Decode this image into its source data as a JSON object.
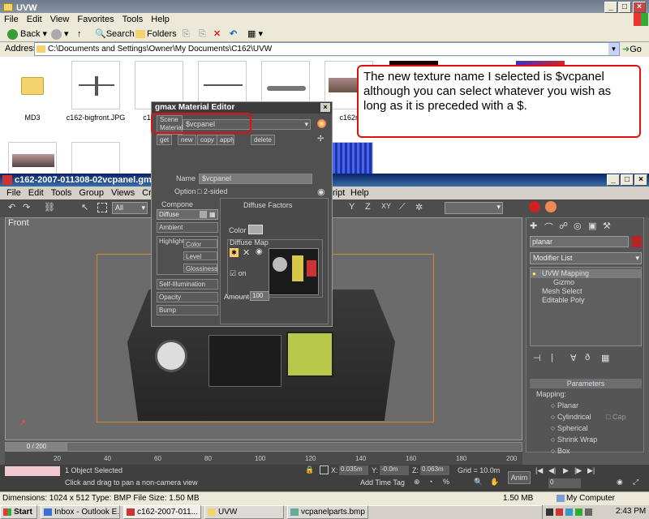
{
  "explorer": {
    "title": "UVW",
    "menu": [
      "File",
      "Edit",
      "View",
      "Favorites",
      "Tools",
      "Help"
    ],
    "toolbar": {
      "back": "Back",
      "search": "Search",
      "folders": "Folders"
    },
    "address_label": "Address",
    "address": "C:\\Documents and Settings\\Owner\\My Documents\\C162\\UVW",
    "go": "Go",
    "files": [
      "MD3",
      "c162-bigfront.JPG",
      "c162",
      "c162rw-le"
    ]
  },
  "note": {
    "text": "The new texture name I selected is $vcpanel although you can select whatever you wish as long as it is preceded with a $."
  },
  "gmax_window": {
    "title": "c162-2007-011308-02vcpanel.gmax - ",
    "menu": [
      "File",
      "Edit",
      "Tools",
      "Group",
      "Views",
      "Create",
      "M"
    ],
    "menu_right": [
      "ript",
      "Help"
    ],
    "dropdown_all": "All",
    "viewport_label": "Front",
    "timeline": "0 / 200",
    "ruler": [
      "20",
      "40",
      "60",
      "80",
      "100",
      "120",
      "140",
      "160",
      "180",
      "200"
    ],
    "status_selected": "1 Object Selected",
    "status_hint": "Click and drag to pan a non-camera view",
    "coords": {
      "x_label": "X:",
      "x": "0.035m",
      "y_label": "Y:",
      "y": "-0.0m",
      "z_label": "Z:",
      "z": "0.063m"
    },
    "grid": "Grid = 10.0m",
    "add_time_tag": "Add Time Tag",
    "anim": "Anim",
    "frame": "0"
  },
  "command_panel": {
    "name": "planar",
    "modifier_list": "Modifier List",
    "stack": [
      "UVW Mapping",
      "Gizmo",
      "Mesh Select",
      "Editable Poly"
    ],
    "parameters": "Parameters",
    "mapping_label": "Mapping:",
    "mapping_options": [
      "Planar",
      "Cylindrical",
      "Spherical",
      "Shrink Wrap",
      "Box"
    ],
    "cap": "Cap"
  },
  "material_editor": {
    "title": "gmax Material Editor",
    "scene_material": "Scene Material",
    "name_dropdown": "$vcpanel",
    "buttons": [
      "get",
      "new",
      "copy",
      "apply",
      "delete"
    ],
    "name_label": "Name",
    "name_value": "$vcpanel",
    "option_label": "Option",
    "two_sided": "2-sided",
    "component_label": "Compone",
    "diffuse_factors": "Diffuse Factors",
    "components": [
      "Diffuse",
      "Ambient",
      "Highlight",
      "Self-Illumination",
      "Opacity",
      "Bump"
    ],
    "highlight_sub": [
      "Color",
      "Level",
      "Glossiness"
    ],
    "color_label": "Color",
    "diffuse_map": "Diffuse Map",
    "on_label": "on",
    "amount_label": "Amount",
    "amount": "100"
  },
  "explorer_status": {
    "info": "Dimensions: 1024 x 512 Type: BMP File Size: 1.50 MB",
    "size": "1.50 MB",
    "zone": "My Computer"
  },
  "taskbar": {
    "start": "Start",
    "items": [
      "Inbox - Outlook E...",
      "c162-2007-011...",
      "UVW",
      "vcpanelparts.bmp ..."
    ],
    "clock": "2:43 PM"
  },
  "colors": {
    "annotation_red": "#dd1111",
    "xp_blue": "#245edb",
    "gmax_dark": "#4b4b4b"
  }
}
